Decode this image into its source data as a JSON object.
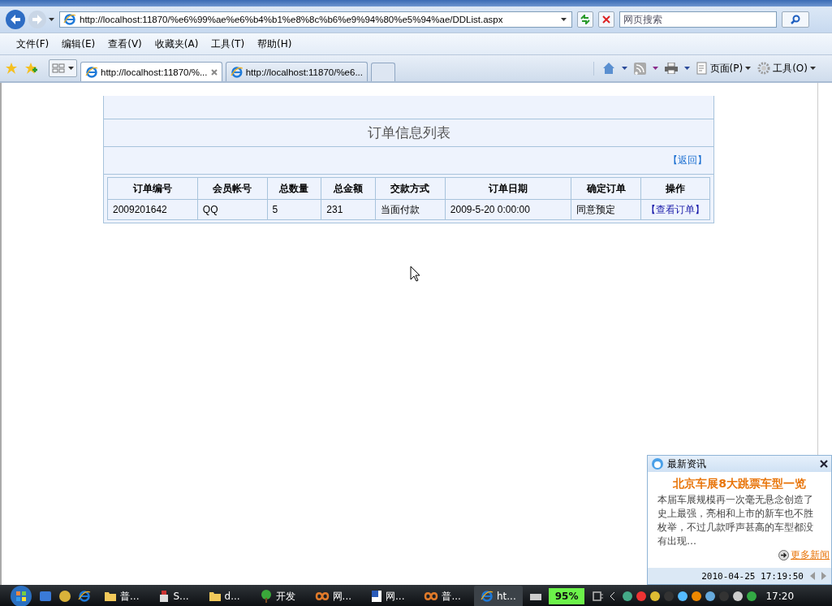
{
  "browser": {
    "address": "http://localhost:11870/%e6%99%ae%e6%b4%b1%e8%8c%b6%e9%94%80%e5%94%ae/DDList.aspx",
    "search_placeholder": "网页搜索",
    "menu": [
      "文件(F)",
      "编辑(E)",
      "查看(V)",
      "收藏夹(A)",
      "工具(T)",
      "帮助(H)"
    ],
    "tabs": [
      {
        "label": "http://localhost:11870/%...",
        "selected": true
      },
      {
        "label": "http://localhost:11870/%e6...",
        "selected": false
      }
    ],
    "commands": [
      "页面(P)",
      "工具(O)"
    ]
  },
  "page": {
    "title": "订单信息列表",
    "back_link": "【返回】",
    "table": {
      "columns": [
        "订单编号",
        "会员帐号",
        "总数量",
        "总金额",
        "交款方式",
        "订单日期",
        "确定订单",
        "操作"
      ],
      "rows": [
        {
          "cells": [
            "2009201642",
            "QQ",
            "5",
            "231",
            "当面付款",
            "2009-5-20 0:00:00",
            "同意预定"
          ],
          "action": "【查看订单】"
        }
      ]
    }
  },
  "news": {
    "title": "最新资讯",
    "headline": "北京车展8大跳票车型一览",
    "body": "本届车展规模再一次毫无悬念创造了史上最强，亮相和上市的新车也不胜枚举，不过几款呼声甚高的车型都没有出现…",
    "more_link": "更多新闻",
    "timestamp": "2010-04-25 17:19:50"
  },
  "taskbar": {
    "tasks": [
      {
        "label": "普...",
        "kind": "folder",
        "selected": false
      },
      {
        "label": "S...",
        "kind": "tool",
        "selected": false
      },
      {
        "label": "d...",
        "kind": "folder",
        "selected": false
      },
      {
        "label": "开发",
        "kind": "tree",
        "selected": false
      },
      {
        "label": "网...",
        "kind": "studio",
        "selected": false
      },
      {
        "label": "网...",
        "kind": "word",
        "selected": false
      },
      {
        "label": "普...",
        "kind": "studio",
        "selected": false
      },
      {
        "label": "ht...",
        "kind": "ie",
        "selected": true
      }
    ],
    "battery": "95%",
    "clock": "17:20"
  }
}
